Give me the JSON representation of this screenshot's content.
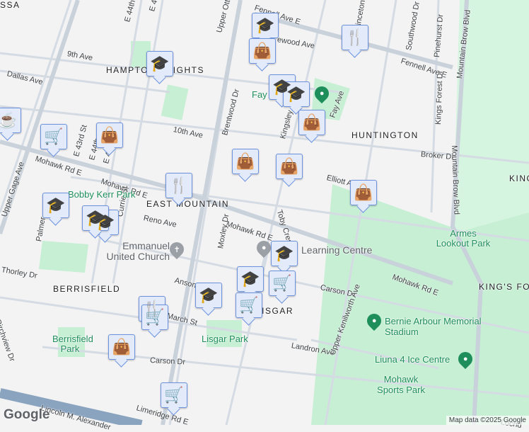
{
  "colors": {
    "background": "#f4f3f4",
    "park": "#c6efd4",
    "road": "#d5dbe3",
    "marker_bg": "#e3ebfb",
    "marker_icon": "#0b4b6f",
    "park_text": "#1e8e5a"
  },
  "areas": [
    "HAMPTON HEIGHTS",
    "EAST MOUNTAIN",
    "HUNTINGTON",
    "BERRISFIELD",
    "LISGAR",
    "KING'S FO",
    "KING L",
    "SSA"
  ],
  "streets": [
    "9th Ave",
    "Dallas Ave",
    "10th Ave",
    "Mohawk Rd E",
    "Mohawk Rd E",
    "Mohawk Rd E",
    "Mohawk Rd E",
    "Upper Ottawa St",
    "E 44th St",
    "E 45th St",
    "E 43rd St",
    "E 44th",
    "E 45th",
    "Upper Gage Ave",
    "Fennell Ave E",
    "Fennell Ave E",
    "Brentwood Dr",
    "Kingsley",
    "Toby Crescent",
    "Elliott Ave",
    "Broker Dr",
    "Fay Ave",
    "Southwood Dr",
    "Pinehurst Dr",
    "Kings Forest Dr",
    "Mountain Brow Blvd",
    "Mountain Brow Blvd",
    "Reno Ave",
    "Currie St",
    "Palmer",
    "Thorley Dr",
    "Birchview Dr",
    "Anson",
    "Moxley Dr",
    "March St",
    "Carson Dr",
    "Carson Dr",
    "Landron Ave",
    "Upper Kenilworth Ave",
    "Limeridge Rd E",
    "Lincoln M. Alexander",
    "Princeton",
    "Lochd",
    "ewood Ave"
  ],
  "parks": [
    "Bobby Kerr Park",
    "Berrisfield Park",
    "Lisgar Park",
    "Armes Lookout Park",
    "Fay"
  ],
  "places": [
    "Emmanuel United Church",
    "Learning Centre",
    "Bernie Arbour Memorial Stadium",
    "Liuna 4 Ice Centre",
    "Mohawk Sports Park"
  ],
  "markers": [
    {
      "type": "school",
      "icon": "graduation-cap-icon"
    },
    {
      "type": "shopping",
      "icon": "shopping-bag-icon"
    },
    {
      "type": "restaurant",
      "icon": "fork-knife-icon"
    },
    {
      "type": "school",
      "icon": "graduation-cap-icon"
    },
    {
      "type": "school",
      "icon": "graduation-cap-icon"
    },
    {
      "type": "school",
      "icon": "graduation-cap-icon"
    },
    {
      "type": "shopping",
      "icon": "shopping-bag-icon"
    },
    {
      "type": "cafe",
      "icon": "coffee-cup-icon"
    },
    {
      "type": "grocery",
      "icon": "shopping-cart-icon"
    },
    {
      "type": "shopping",
      "icon": "shopping-bag-icon"
    },
    {
      "type": "shopping",
      "icon": "shopping-bag-icon"
    },
    {
      "type": "shopping",
      "icon": "shopping-bag-icon"
    },
    {
      "type": "restaurant",
      "icon": "fork-knife-icon"
    },
    {
      "type": "shopping",
      "icon": "shopping-bag-icon"
    },
    {
      "type": "school",
      "icon": "graduation-cap-icon"
    },
    {
      "type": "school",
      "icon": "graduation-cap-icon"
    },
    {
      "type": "school",
      "icon": "graduation-cap-icon"
    },
    {
      "type": "school",
      "icon": "graduation-cap-icon"
    },
    {
      "type": "school",
      "icon": "graduation-cap-icon"
    },
    {
      "type": "grocery",
      "icon": "shopping-cart-icon"
    },
    {
      "type": "school",
      "icon": "graduation-cap-icon"
    },
    {
      "type": "grocery",
      "icon": "shopping-cart-icon"
    },
    {
      "type": "restaurant",
      "icon": "fork-knife-icon"
    },
    {
      "type": "grocery",
      "icon": "shopping-cart-icon"
    },
    {
      "type": "shopping",
      "icon": "shopping-bag-icon"
    },
    {
      "type": "grocery",
      "icon": "shopping-cart-icon"
    }
  ],
  "branding": {
    "logo": "Google",
    "attribution": "Map data ©2025 Google"
  }
}
